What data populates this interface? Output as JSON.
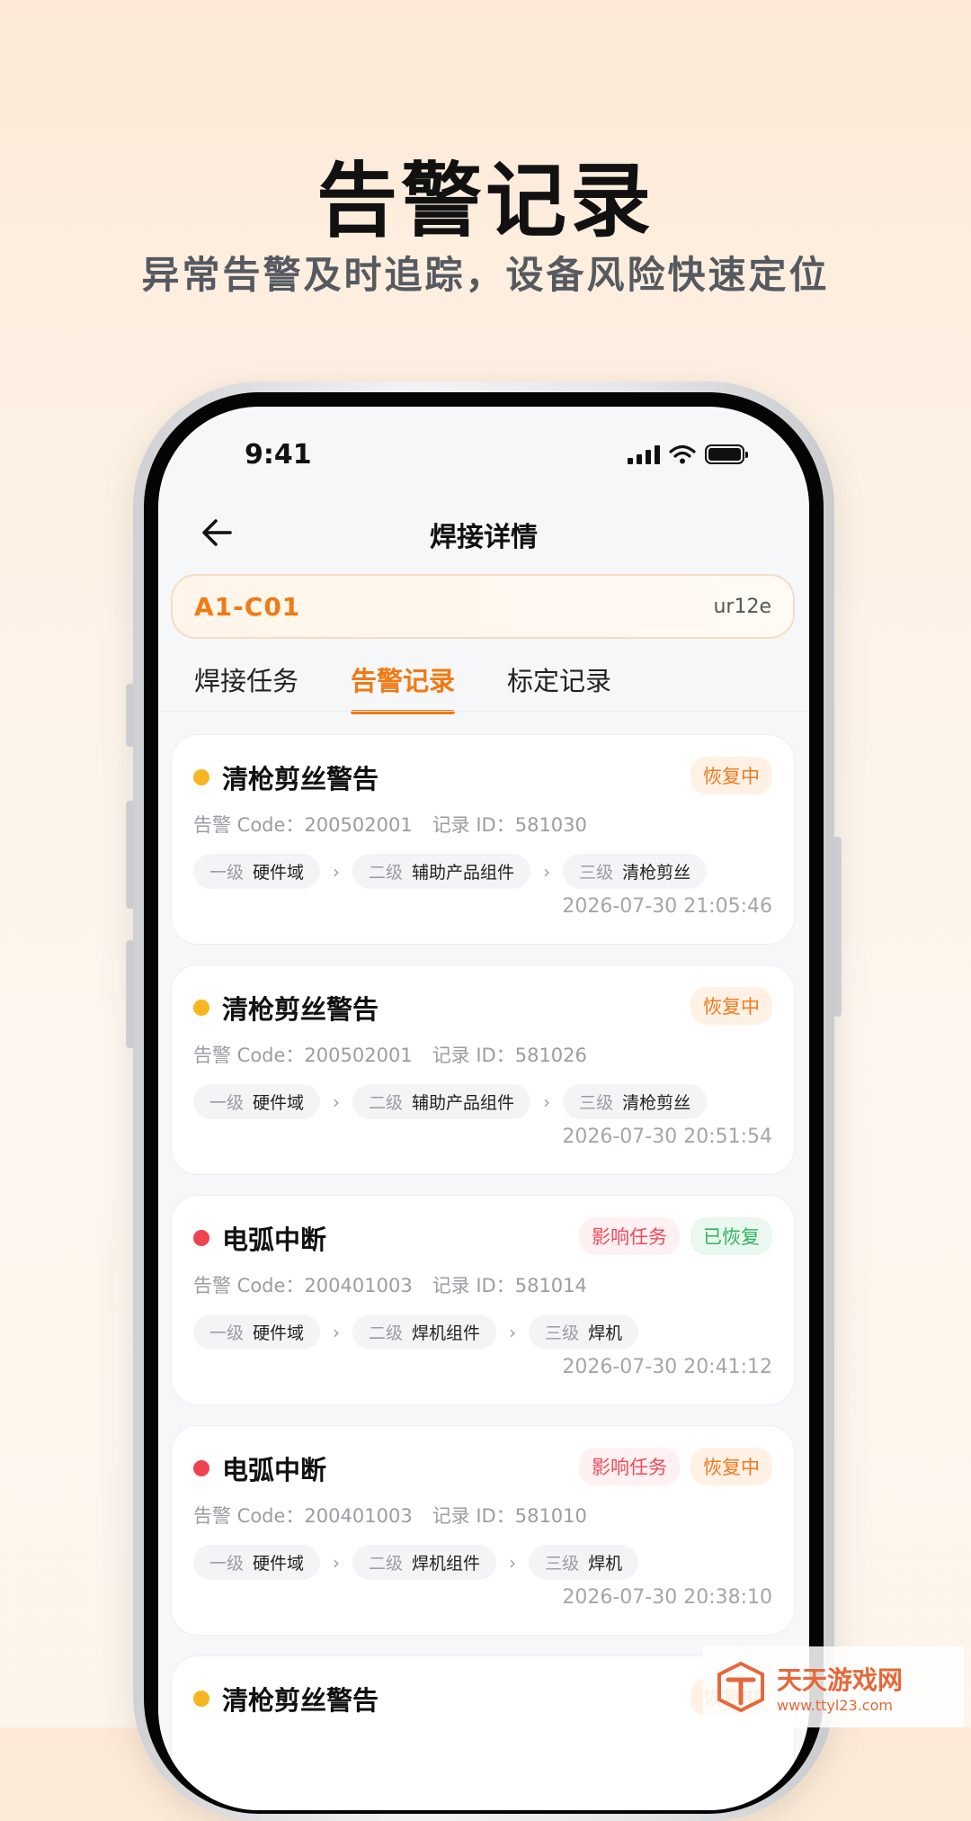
{
  "hero": {
    "title": "告警记录",
    "subtitle": "异常告警及时追踪，设备风险快速定位"
  },
  "status_bar": {
    "time": "9:41"
  },
  "nav": {
    "title": "焊接详情"
  },
  "device": {
    "id": "A1-C01",
    "user": "ur12e"
  },
  "tabs": [
    {
      "label": "焊接任务",
      "active": false
    },
    {
      "label": "告警记录",
      "active": true
    },
    {
      "label": "标定记录",
      "active": false
    }
  ],
  "alerts": [
    {
      "title": "清枪剪丝警告",
      "dot_color": "#f7b522",
      "badges": [
        {
          "label": "恢复中",
          "style": "orange"
        }
      ],
      "code_text": "告警 Code：200502001",
      "record_text": "记录 ID：581030",
      "path": [
        {
          "level": "一级",
          "value": "硬件域"
        },
        {
          "level": "二级",
          "value": "辅助产品组件"
        },
        {
          "level": "三级",
          "value": "清枪剪丝"
        }
      ],
      "time": "2026-07-30 21:05:46"
    },
    {
      "title": "清枪剪丝警告",
      "dot_color": "#f7b522",
      "badges": [
        {
          "label": "恢复中",
          "style": "orange"
        }
      ],
      "code_text": "告警 Code：200502001",
      "record_text": "记录 ID：581026",
      "path": [
        {
          "level": "一级",
          "value": "硬件域"
        },
        {
          "level": "二级",
          "value": "辅助产品组件"
        },
        {
          "level": "三级",
          "value": "清枪剪丝"
        }
      ],
      "time": "2026-07-30 20:51:54"
    },
    {
      "title": "电弧中断",
      "dot_color": "#ee4452",
      "badges": [
        {
          "label": "影响任务",
          "style": "red"
        },
        {
          "label": "已恢复",
          "style": "green"
        }
      ],
      "code_text": "告警 Code：200401003",
      "record_text": "记录 ID：581014",
      "path": [
        {
          "level": "一级",
          "value": "硬件域"
        },
        {
          "level": "二级",
          "value": "焊机组件"
        },
        {
          "level": "三级",
          "value": "焊机"
        }
      ],
      "time": "2026-07-30 20:41:12"
    },
    {
      "title": "电弧中断",
      "dot_color": "#ee4452",
      "badges": [
        {
          "label": "影响任务",
          "style": "red"
        },
        {
          "label": "恢复中",
          "style": "orange"
        }
      ],
      "code_text": "告警 Code：200401003",
      "record_text": "记录 ID：581010",
      "path": [
        {
          "level": "一级",
          "value": "硬件域"
        },
        {
          "level": "二级",
          "value": "焊机组件"
        },
        {
          "level": "三级",
          "value": "焊机"
        }
      ],
      "time": "2026-07-30 20:38:10"
    },
    {
      "title": "清枪剪丝警告",
      "dot_color": "#f7b522",
      "badges": [
        {
          "label": "恢复中",
          "style": "orange"
        }
      ],
      "code_text": "",
      "record_text": "",
      "path": [],
      "time": ""
    }
  ],
  "watermark": {
    "name": "天天游戏网",
    "url": "www.ttyl23.com"
  },
  "colors": {
    "accent": "#f07a14",
    "background": "#fdf1e4",
    "screen": "#f6f7f9"
  }
}
